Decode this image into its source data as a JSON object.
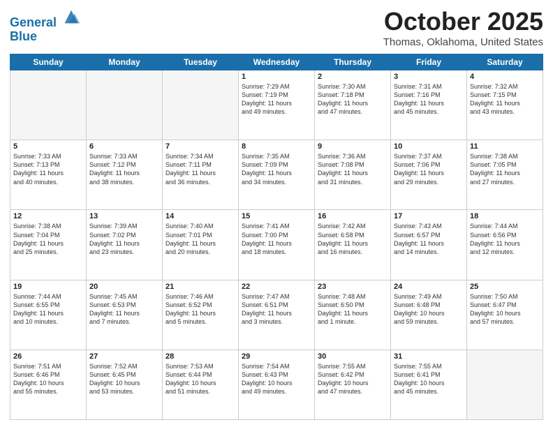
{
  "header": {
    "logo_line1": "General",
    "logo_line2": "Blue",
    "month": "October 2025",
    "location": "Thomas, Oklahoma, United States"
  },
  "days_of_week": [
    "Sunday",
    "Monday",
    "Tuesday",
    "Wednesday",
    "Thursday",
    "Friday",
    "Saturday"
  ],
  "weeks": [
    [
      {
        "day": "",
        "info": ""
      },
      {
        "day": "",
        "info": ""
      },
      {
        "day": "",
        "info": ""
      },
      {
        "day": "1",
        "info": "Sunrise: 7:29 AM\nSunset: 7:19 PM\nDaylight: 11 hours\nand 49 minutes."
      },
      {
        "day": "2",
        "info": "Sunrise: 7:30 AM\nSunset: 7:18 PM\nDaylight: 11 hours\nand 47 minutes."
      },
      {
        "day": "3",
        "info": "Sunrise: 7:31 AM\nSunset: 7:16 PM\nDaylight: 11 hours\nand 45 minutes."
      },
      {
        "day": "4",
        "info": "Sunrise: 7:32 AM\nSunset: 7:15 PM\nDaylight: 11 hours\nand 43 minutes."
      }
    ],
    [
      {
        "day": "5",
        "info": "Sunrise: 7:33 AM\nSunset: 7:13 PM\nDaylight: 11 hours\nand 40 minutes."
      },
      {
        "day": "6",
        "info": "Sunrise: 7:33 AM\nSunset: 7:12 PM\nDaylight: 11 hours\nand 38 minutes."
      },
      {
        "day": "7",
        "info": "Sunrise: 7:34 AM\nSunset: 7:11 PM\nDaylight: 11 hours\nand 36 minutes."
      },
      {
        "day": "8",
        "info": "Sunrise: 7:35 AM\nSunset: 7:09 PM\nDaylight: 11 hours\nand 34 minutes."
      },
      {
        "day": "9",
        "info": "Sunrise: 7:36 AM\nSunset: 7:08 PM\nDaylight: 11 hours\nand 31 minutes."
      },
      {
        "day": "10",
        "info": "Sunrise: 7:37 AM\nSunset: 7:06 PM\nDaylight: 11 hours\nand 29 minutes."
      },
      {
        "day": "11",
        "info": "Sunrise: 7:38 AM\nSunset: 7:05 PM\nDaylight: 11 hours\nand 27 minutes."
      }
    ],
    [
      {
        "day": "12",
        "info": "Sunrise: 7:38 AM\nSunset: 7:04 PM\nDaylight: 11 hours\nand 25 minutes."
      },
      {
        "day": "13",
        "info": "Sunrise: 7:39 AM\nSunset: 7:02 PM\nDaylight: 11 hours\nand 23 minutes."
      },
      {
        "day": "14",
        "info": "Sunrise: 7:40 AM\nSunset: 7:01 PM\nDaylight: 11 hours\nand 20 minutes."
      },
      {
        "day": "15",
        "info": "Sunrise: 7:41 AM\nSunset: 7:00 PM\nDaylight: 11 hours\nand 18 minutes."
      },
      {
        "day": "16",
        "info": "Sunrise: 7:42 AM\nSunset: 6:58 PM\nDaylight: 11 hours\nand 16 minutes."
      },
      {
        "day": "17",
        "info": "Sunrise: 7:43 AM\nSunset: 6:57 PM\nDaylight: 11 hours\nand 14 minutes."
      },
      {
        "day": "18",
        "info": "Sunrise: 7:44 AM\nSunset: 6:56 PM\nDaylight: 11 hours\nand 12 minutes."
      }
    ],
    [
      {
        "day": "19",
        "info": "Sunrise: 7:44 AM\nSunset: 6:55 PM\nDaylight: 11 hours\nand 10 minutes."
      },
      {
        "day": "20",
        "info": "Sunrise: 7:45 AM\nSunset: 6:53 PM\nDaylight: 11 hours\nand 7 minutes."
      },
      {
        "day": "21",
        "info": "Sunrise: 7:46 AM\nSunset: 6:52 PM\nDaylight: 11 hours\nand 5 minutes."
      },
      {
        "day": "22",
        "info": "Sunrise: 7:47 AM\nSunset: 6:51 PM\nDaylight: 11 hours\nand 3 minutes."
      },
      {
        "day": "23",
        "info": "Sunrise: 7:48 AM\nSunset: 6:50 PM\nDaylight: 11 hours\nand 1 minute."
      },
      {
        "day": "24",
        "info": "Sunrise: 7:49 AM\nSunset: 6:48 PM\nDaylight: 10 hours\nand 59 minutes."
      },
      {
        "day": "25",
        "info": "Sunrise: 7:50 AM\nSunset: 6:47 PM\nDaylight: 10 hours\nand 57 minutes."
      }
    ],
    [
      {
        "day": "26",
        "info": "Sunrise: 7:51 AM\nSunset: 6:46 PM\nDaylight: 10 hours\nand 55 minutes."
      },
      {
        "day": "27",
        "info": "Sunrise: 7:52 AM\nSunset: 6:45 PM\nDaylight: 10 hours\nand 53 minutes."
      },
      {
        "day": "28",
        "info": "Sunrise: 7:53 AM\nSunset: 6:44 PM\nDaylight: 10 hours\nand 51 minutes."
      },
      {
        "day": "29",
        "info": "Sunrise: 7:54 AM\nSunset: 6:43 PM\nDaylight: 10 hours\nand 49 minutes."
      },
      {
        "day": "30",
        "info": "Sunrise: 7:55 AM\nSunset: 6:42 PM\nDaylight: 10 hours\nand 47 minutes."
      },
      {
        "day": "31",
        "info": "Sunrise: 7:55 AM\nSunset: 6:41 PM\nDaylight: 10 hours\nand 45 minutes."
      },
      {
        "day": "",
        "info": ""
      }
    ]
  ]
}
